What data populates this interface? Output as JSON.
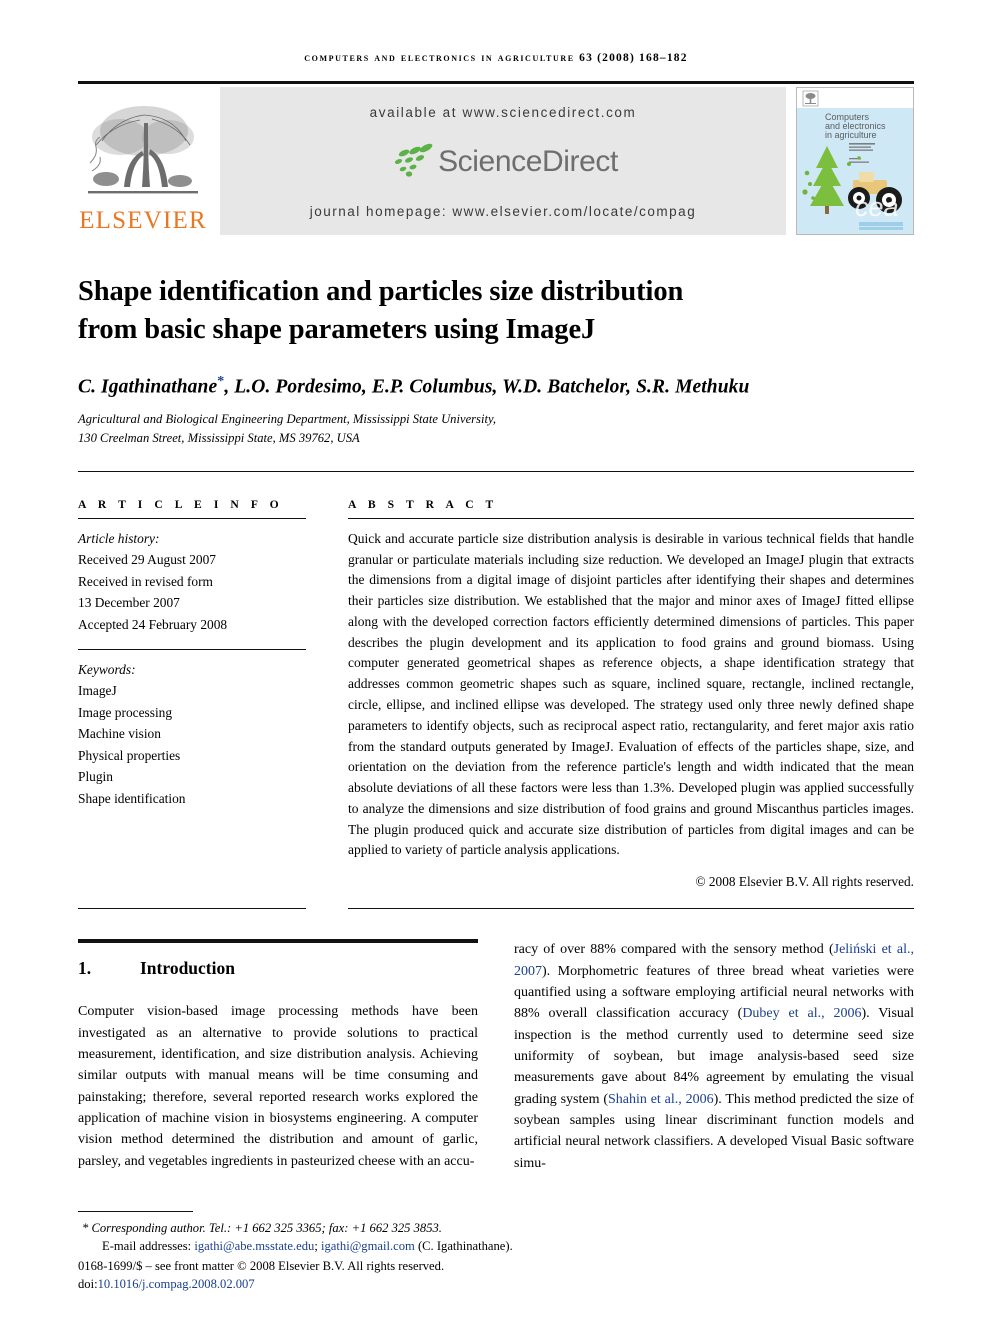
{
  "running_head": {
    "journal": "COMPUTERS AND ELECTRONICS IN AGRICULTURE",
    "volume_year_pages": "63 (2008) 168–182"
  },
  "masthead": {
    "publisher_name": "ELSEVIER",
    "publisher_logo_icon": "elsevier-tree-icon",
    "available_at": "available at www.sciencedirect.com",
    "sciencedirect_word": "ScienceDirect",
    "sciencedirect_logo_icon": "sciencedirect-swoosh-icon",
    "journal_homepage": "journal homepage: www.elsevier.com/locate/compag",
    "cover": {
      "title_line1": "Computers",
      "title_line2": "and electronics",
      "title_line3": "in agriculture",
      "mark": "cea",
      "badge_icon": "elsevier-tree-badge-icon"
    },
    "colors": {
      "elsevier_orange": "#E87722",
      "sciencedirect_green": "#5CB247",
      "sciencedirect_gray": "#6e6e6e",
      "band_gray": "#e7e7e7",
      "cover_blue": "#cfe8f5"
    }
  },
  "article": {
    "title_line1": "Shape identification and particles size distribution",
    "title_line2": "from basic shape parameters using ImageJ",
    "authors": "C. Igathinathane",
    "authors_rest": ", L.O. Pordesimo, E.P. Columbus, W.D. Batchelor, S.R. Methuku",
    "corresponding_marker": "*",
    "affiliation_line1": "Agricultural and Biological Engineering Department, Mississippi State University,",
    "affiliation_line2": "130 Creelman Street, Mississippi State, MS 39762, USA"
  },
  "article_info": {
    "label": "A R T I C L E   I N F O",
    "history_label": "Article history:",
    "history": [
      "Received 29 August 2007",
      "Received in revised form",
      "13 December 2007",
      "Accepted 24 February 2008"
    ],
    "keywords_label": "Keywords:",
    "keywords": [
      "ImageJ",
      "Image processing",
      "Machine vision",
      "Physical properties",
      "Plugin",
      "Shape identification"
    ]
  },
  "abstract": {
    "label": "A B S T R A C T",
    "text": "Quick and accurate particle size distribution analysis is desirable in various technical fields that handle granular or particulate materials including size reduction. We developed an ImageJ plugin that extracts the dimensions from a digital image of disjoint particles after identifying their shapes and determines their particles size distribution. We established that the major and minor axes of ImageJ fitted ellipse along with the developed correction factors efficiently determined dimensions of particles. This paper describes the plugin development and its application to food grains and ground biomass. Using computer generated geometrical shapes as reference objects, a shape identification strategy that addresses common geometric shapes such as square, inclined square, rectangle, inclined rectangle, circle, ellipse, and inclined ellipse was developed. The strategy used only three newly defined shape parameters to identify objects, such as reciprocal aspect ratio, rectangularity, and feret major axis ratio from the standard outputs generated by ImageJ. Evaluation of effects of the particles shape, size, and orientation on the deviation from the reference particle's length and width indicated that the mean absolute deviations of all these factors were less than 1.3%. Developed plugin was applied successfully to analyze the dimensions and size distribution of food grains and ground Miscanthus particles images. The plugin produced quick and accurate size distribution of particles from digital images and can be applied to variety of particle analysis applications.",
    "copyright": "© 2008 Elsevier B.V. All rights reserved."
  },
  "body": {
    "section_number": "1.",
    "section_title": "Introduction",
    "left_column": "Computer vision-based image processing methods have been investigated as an alternative to provide solutions to practical measurement, identification, and size distribution analysis. Achieving similar outputs with manual means will be time consuming and painstaking; therefore, several reported research works explored the application of machine vision in biosystems engineering. A computer vision method determined the distribution and amount of garlic, parsley, and vegetables ingredients in pasteurized cheese with an accu-",
    "right_column_part1": "racy of over 88% compared with the sensory method (",
    "right_column_cite1": "Jeliński et al., 2007",
    "right_column_part2": "). Morphometric features of three bread wheat varieties were quantified using a software employing artificial neural networks with 88% overall classification accuracy (",
    "right_column_cite2": "Dubey et al., 2006",
    "right_column_part3": "). Visual inspection is the method currently used to determine seed size uniformity of soybean, but image analysis-based seed size measurements gave about 84% agreement by emulating the visual grading system (",
    "right_column_cite3": "Shahin et al., 2006",
    "right_column_part4": "). This method predicted the size of soybean samples using linear discriminant function models and artificial neural network classifiers. A developed Visual Basic software simu-"
  },
  "footnotes": {
    "corresponding_marker": "*",
    "corresponding": "Corresponding author. Tel.: +1 662 325 3365; fax: +1 662 325 3853.",
    "email_label": "E-mail addresses:",
    "email1": "igathi@abe.msstate.edu",
    "email_sep": "; ",
    "email2": "igathi@gmail.com",
    "email_suffix": " (C. Igathinathane).",
    "issn_line": "0168-1699/$ – see front matter © 2008 Elsevier B.V. All rights reserved.",
    "doi_label": "doi:",
    "doi_value": "10.1016/j.compag.2008.02.007"
  }
}
